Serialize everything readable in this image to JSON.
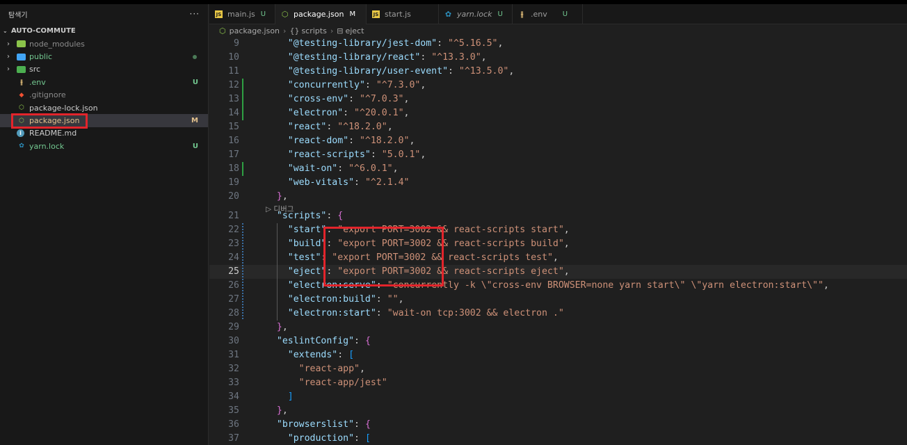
{
  "sidebar": {
    "title": "탐색기",
    "more": "···",
    "root": "AUTO-COMMUTE",
    "items": [
      {
        "label": "node_modules",
        "badge": "",
        "icon": "folder-node-icon"
      },
      {
        "label": "public",
        "badge": "",
        "icon": "folder-public-icon"
      },
      {
        "label": "src",
        "badge": "",
        "icon": "folder-src-icon"
      },
      {
        "label": ".env",
        "badge": "U",
        "icon": "settings-env-icon"
      },
      {
        "label": ".gitignore",
        "badge": "",
        "icon": "git-icon"
      },
      {
        "label": "package-lock.json",
        "badge": "",
        "icon": "npm-icon"
      },
      {
        "label": "package.json",
        "badge": "M",
        "icon": "npm-icon"
      },
      {
        "label": "README.md",
        "badge": "",
        "icon": "info-icon"
      },
      {
        "label": "yarn.lock",
        "badge": "U",
        "icon": "yarn-icon"
      }
    ]
  },
  "tabs": [
    {
      "label": "main.js",
      "badge": "U",
      "icon": "js-file-icon"
    },
    {
      "label": "package.json",
      "badge": "M",
      "icon": "npm-icon"
    },
    {
      "label": "start.js",
      "badge": "",
      "icon": "js-file-icon"
    },
    {
      "label": "yarn.lock",
      "badge": "U",
      "icon": "yarn-icon"
    },
    {
      "label": ".env",
      "badge": "U",
      "icon": "settings-env-icon"
    }
  ],
  "breadcrumb": {
    "file": "package.json",
    "symbol1": "scripts",
    "symbol2": "eject",
    "sym1_glyph": "{}",
    "sym2_glyph": "⊟"
  },
  "editor": {
    "codelens": "▷ 디버그",
    "current_line": 25,
    "lines": [
      {
        "n": "9",
        "t": [
          [
            "key",
            "    \"@testing-library/jest-dom\""
          ],
          [
            "pun",
            ": "
          ],
          [
            "str",
            "\"^5.16.5\""
          ],
          [
            "pun",
            ","
          ]
        ]
      },
      {
        "n": "10",
        "t": [
          [
            "key",
            "    \"@testing-library/react\""
          ],
          [
            "pun",
            ": "
          ],
          [
            "str",
            "\"^13.3.0\""
          ],
          [
            "pun",
            ","
          ]
        ]
      },
      {
        "n": "11",
        "t": [
          [
            "key",
            "    \"@testing-library/user-event\""
          ],
          [
            "pun",
            ": "
          ],
          [
            "str",
            "\"^13.5.0\""
          ],
          [
            "pun",
            ","
          ]
        ]
      },
      {
        "n": "12",
        "t": [
          [
            "key",
            "    \"concurrently\""
          ],
          [
            "pun",
            ": "
          ],
          [
            "str",
            "\"^7.3.0\""
          ],
          [
            "pun",
            ","
          ]
        ]
      },
      {
        "n": "13",
        "t": [
          [
            "key",
            "    \"cross-env\""
          ],
          [
            "pun",
            ": "
          ],
          [
            "str",
            "\"^7.0.3\""
          ],
          [
            "pun",
            ","
          ]
        ]
      },
      {
        "n": "14",
        "t": [
          [
            "key",
            "    \"electron\""
          ],
          [
            "pun",
            ": "
          ],
          [
            "str",
            "\"^20.0.1\""
          ],
          [
            "pun",
            ","
          ]
        ]
      },
      {
        "n": "15",
        "t": [
          [
            "key",
            "    \"react\""
          ],
          [
            "pun",
            ": "
          ],
          [
            "str",
            "\"^18.2.0\""
          ],
          [
            "pun",
            ","
          ]
        ]
      },
      {
        "n": "16",
        "t": [
          [
            "key",
            "    \"react-dom\""
          ],
          [
            "pun",
            ": "
          ],
          [
            "str",
            "\"^18.2.0\""
          ],
          [
            "pun",
            ","
          ]
        ]
      },
      {
        "n": "17",
        "t": [
          [
            "key",
            "    \"react-scripts\""
          ],
          [
            "pun",
            ": "
          ],
          [
            "str",
            "\"5.0.1\""
          ],
          [
            "pun",
            ","
          ]
        ]
      },
      {
        "n": "18",
        "t": [
          [
            "key",
            "    \"wait-on\""
          ],
          [
            "pun",
            ": "
          ],
          [
            "str",
            "\"^6.0.1\""
          ],
          [
            "pun",
            ","
          ]
        ]
      },
      {
        "n": "19",
        "t": [
          [
            "key",
            "    \"web-vitals\""
          ],
          [
            "pun",
            ": "
          ],
          [
            "str",
            "\"^2.1.4\""
          ]
        ]
      },
      {
        "n": "20",
        "t": [
          [
            "b1",
            "  }"
          ],
          [
            "pun",
            ","
          ]
        ]
      },
      {
        "n": "21",
        "t": [
          [
            "key",
            "  \"scripts\""
          ],
          [
            "pun",
            ": "
          ],
          [
            "b1",
            "{"
          ]
        ]
      },
      {
        "n": "22",
        "t": [
          [
            "key",
            "    \"start\""
          ],
          [
            "pun",
            ": "
          ],
          [
            "str",
            "\"export PORT=3002 && react-scripts start\""
          ],
          [
            "pun",
            ","
          ]
        ]
      },
      {
        "n": "23",
        "t": [
          [
            "key",
            "    \"build\""
          ],
          [
            "pun",
            ": "
          ],
          [
            "str",
            "\"export PORT=3002 && react-scripts build\""
          ],
          [
            "pun",
            ","
          ]
        ]
      },
      {
        "n": "24",
        "t": [
          [
            "key",
            "    \"test\""
          ],
          [
            "pun",
            ": "
          ],
          [
            "str",
            "\"export PORT=3002 && react-scripts test\""
          ],
          [
            "pun",
            ","
          ]
        ]
      },
      {
        "n": "25",
        "t": [
          [
            "key",
            "    \"eject\""
          ],
          [
            "pun",
            ": "
          ],
          [
            "str",
            "\"export PORT=3002 && react-scripts eject\""
          ],
          [
            "pun",
            ","
          ]
        ]
      },
      {
        "n": "26",
        "t": [
          [
            "key",
            "    \"electron:serve\""
          ],
          [
            "pun",
            ": "
          ],
          [
            "str",
            "\"concurrently -k \\\"cross-env BROWSER=none yarn start\\\" \\\"yarn electron:start\\\"\""
          ],
          [
            "pun",
            ","
          ]
        ]
      },
      {
        "n": "27",
        "t": [
          [
            "key",
            "    \"electron:build\""
          ],
          [
            "pun",
            ": "
          ],
          [
            "str",
            "\"\""
          ],
          [
            "pun",
            ","
          ]
        ]
      },
      {
        "n": "28",
        "t": [
          [
            "key",
            "    \"electron:start\""
          ],
          [
            "pun",
            ": "
          ],
          [
            "str",
            "\"wait-on tcp:3002 && electron .\""
          ]
        ]
      },
      {
        "n": "29",
        "t": [
          [
            "b1",
            "  }"
          ],
          [
            "pun",
            ","
          ]
        ]
      },
      {
        "n": "30",
        "t": [
          [
            "key",
            "  \"eslintConfig\""
          ],
          [
            "pun",
            ": "
          ],
          [
            "b1",
            "{"
          ]
        ]
      },
      {
        "n": "31",
        "t": [
          [
            "key",
            "    \"extends\""
          ],
          [
            "pun",
            ": "
          ],
          [
            "b2",
            "["
          ]
        ]
      },
      {
        "n": "32",
        "t": [
          [
            "str",
            "      \"react-app\""
          ],
          [
            "pun",
            ","
          ]
        ]
      },
      {
        "n": "33",
        "t": [
          [
            "str",
            "      \"react-app/jest\""
          ]
        ]
      },
      {
        "n": "34",
        "t": [
          [
            "b2",
            "    ]"
          ]
        ]
      },
      {
        "n": "35",
        "t": [
          [
            "b1",
            "  }"
          ],
          [
            "pun",
            ","
          ]
        ]
      },
      {
        "n": "36",
        "t": [
          [
            "key",
            "  \"browserslist\""
          ],
          [
            "pun",
            ": "
          ],
          [
            "b1",
            "{"
          ]
        ]
      },
      {
        "n": "37",
        "t": [
          [
            "key",
            "    \"production\""
          ],
          [
            "pun",
            ": "
          ],
          [
            "b2",
            "["
          ]
        ]
      }
    ]
  },
  "colors": {
    "highlight_box": "#e3242b",
    "untracked": "#73c991",
    "modified": "#e2c08d"
  }
}
